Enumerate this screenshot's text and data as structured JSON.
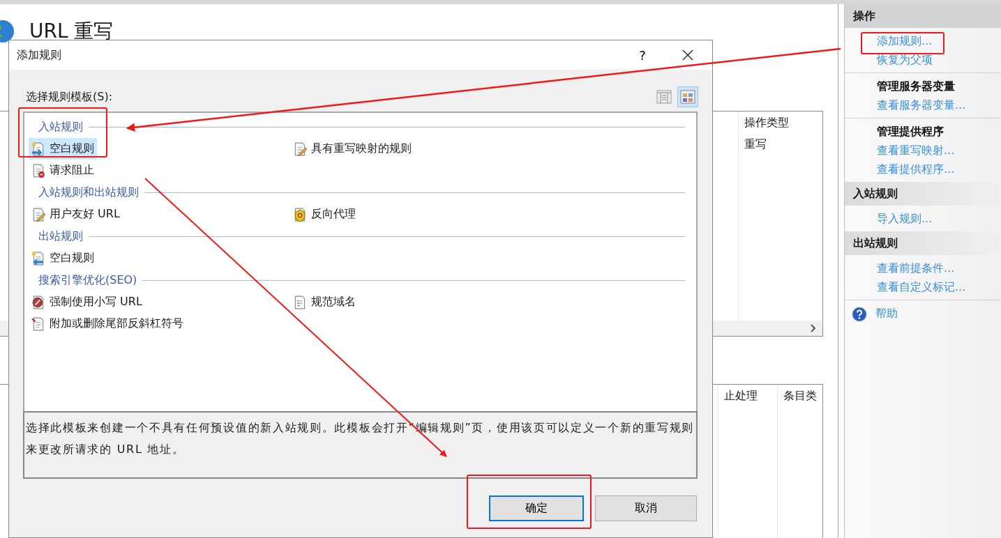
{
  "page": {
    "title": "URL 重写"
  },
  "rules_table": {
    "columns": [
      "操作类型"
    ],
    "rows": [
      [
        "重写"
      ]
    ]
  },
  "conditions_table": {
    "columns": [
      "止处理",
      "条目类"
    ]
  },
  "actions": {
    "groups": [
      {
        "title": "操作",
        "items": [
          {
            "kind": "link",
            "label": "添加规则..."
          },
          {
            "kind": "link",
            "label": "恢复为父项"
          }
        ]
      },
      {
        "items": [
          {
            "kind": "heading",
            "label": "管理服务器变量"
          },
          {
            "kind": "link",
            "label": "查看服务器变量..."
          }
        ]
      },
      {
        "items": [
          {
            "kind": "heading",
            "label": "管理提供程序"
          },
          {
            "kind": "link",
            "label": "查看重写映射..."
          },
          {
            "kind": "link",
            "label": "查看提供程序..."
          }
        ]
      },
      {
        "title": "入站规则",
        "items": [
          {
            "kind": "link",
            "label": "导入规则..."
          }
        ]
      },
      {
        "title": "出站规则",
        "items": [
          {
            "kind": "link",
            "label": "查看前提条件..."
          },
          {
            "kind": "link",
            "label": "查看自定义标记..."
          }
        ]
      },
      {
        "items": [
          {
            "kind": "help",
            "label": "帮助"
          }
        ]
      }
    ]
  },
  "dialog": {
    "title": "添加规则",
    "help": "?",
    "label": "选择规则模板(S):",
    "views": [
      {
        "kind": "details",
        "selected": false
      },
      {
        "kind": "tiles",
        "selected": true
      }
    ],
    "template_groups": [
      {
        "title": "入站规则",
        "items": [
          {
            "label": "空白规则",
            "selected": true
          },
          {
            "label": "具有重写映射的规则",
            "selected": false
          },
          {
            "label": "请求阻止",
            "selected": false
          }
        ]
      },
      {
        "title": "入站规则和出站规则",
        "items": [
          {
            "label": "用户友好 URL",
            "selected": false
          },
          {
            "label": "反向代理",
            "selected": false
          }
        ]
      },
      {
        "title": "出站规则",
        "items": [
          {
            "label": "空白规则",
            "selected": false
          }
        ]
      },
      {
        "title": "搜索引擎优化(SEO)",
        "items": [
          {
            "label": "强制使用小写 URL",
            "selected": false
          },
          {
            "label": "规范域名",
            "selected": false
          },
          {
            "label": "附加或删除尾部反斜杠符号",
            "selected": false
          }
        ]
      }
    ],
    "description": "选择此模板来创建一个不具有任何预设值的新入站规则。此模板会打开“编辑规则”页，使用该页可以定义一个新的重写规则来更改所请求的 URL 地址。",
    "buttons": [
      {
        "label": "确定",
        "kind": "default"
      },
      {
        "label": "取消",
        "kind": "normal"
      }
    ]
  },
  "annotations": [
    {
      "kind": "frame"
    },
    {
      "kind": "frame"
    },
    {
      "kind": "frame"
    },
    {
      "kind": "arrow"
    },
    {
      "kind": "arrow"
    }
  ]
}
